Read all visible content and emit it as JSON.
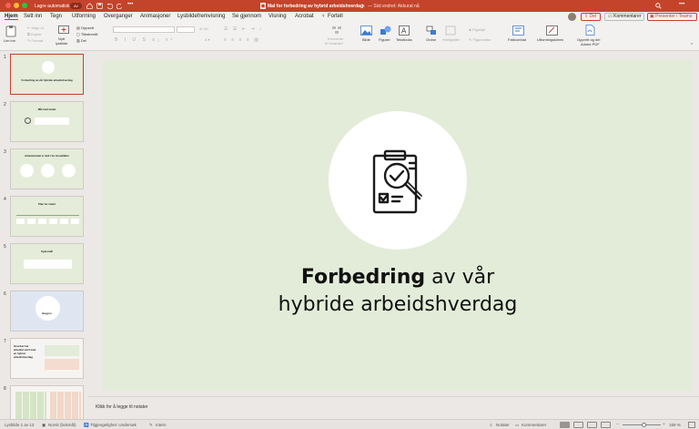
{
  "titlebar": {
    "autosave_label": "Lagre automatisk",
    "autosave_state": "AV",
    "doc_title": "Mal for forbedring av hybrid arbeidshverdag",
    "last_changed": "— Sist endret: Akkurat nå"
  },
  "menu": {
    "tabs": [
      "Hjem",
      "Sett inn",
      "Tegn",
      "Utforming",
      "Overganger",
      "Animasjoner",
      "Lysbildefremvisning",
      "Se gjennom",
      "Visning",
      "Acrobat",
      "Fortell"
    ],
    "share": "Del",
    "comments": "Kommentarer",
    "present": "Presenter i Teams"
  },
  "ribbon": {
    "paste": "Lim inn",
    "cut": "Klipp ut",
    "copy": "Kopier",
    "format": "Format",
    "new_slide_l1": "Nytt",
    "new_slide_l2": "lysbilde",
    "layout": "Oppsett",
    "reset": "Tilbakestill",
    "section": "Del",
    "convert_l1": "Konverter",
    "convert_l2": "til SmartArt",
    "picture": "Bilde",
    "shapes": "Figurer",
    "textbox": "Tekstboks",
    "arrange": "Ordne",
    "quick_styles": "Hurtigstiler",
    "shape_fill": "Figurfyll",
    "shape_outline": "Figurkontur",
    "design_ideas": "Fattcombat",
    "designer": "Utformingsideen",
    "adobe_l1": "Opprett og del",
    "adobe_l2": "Adobe PDF"
  },
  "thumbnails": [
    {
      "num": "1",
      "title": "Forbedring av vår hybride arbeidshverdag"
    },
    {
      "num": "2",
      "title": "Mål med møtet"
    },
    {
      "num": "3",
      "title": "Arbeidsmøtet er delt i tre hovedåkter"
    },
    {
      "num": "4",
      "title": "Plan for møtet"
    },
    {
      "num": "5",
      "title": "Spørsmål"
    },
    {
      "num": "6",
      "title": "Begynn"
    },
    {
      "num": "7",
      "title": "Hvordan har arbeidet vært med en hybrid arbeidshverdag"
    },
    {
      "num": "8",
      "title": ""
    }
  ],
  "slide": {
    "title_bold": "Forbedring",
    "title_rest": " av vår",
    "title_line2": "hybride arbeidshverdag"
  },
  "notes_placeholder": "Klikk for å legge til notater",
  "status": {
    "slide_count": "Lysbilde 1 av 13",
    "language": "Norsk (bokmål)",
    "accessibility": "Tilgjengelighet: Undersøk",
    "sensitivity": "Intern",
    "notes": "Notater",
    "comments": "Kommentarer",
    "zoom": "169 %"
  },
  "colors": {
    "brand": "#c4432b",
    "slide_bg": "#e3ecd8"
  }
}
